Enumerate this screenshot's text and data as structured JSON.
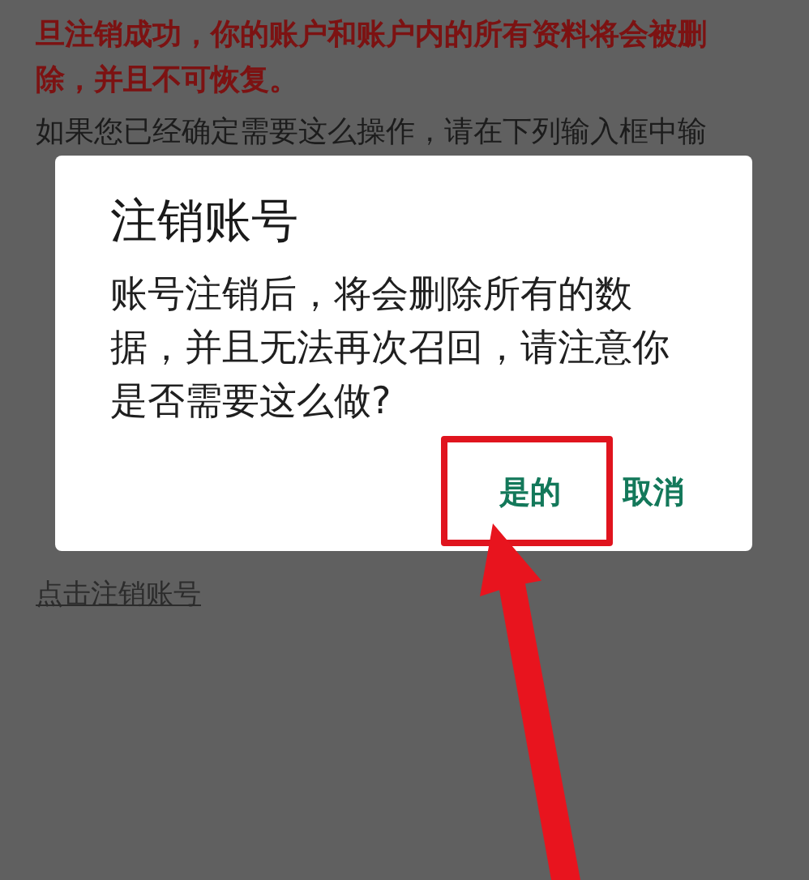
{
  "warning": {
    "lines": [
      "旦注销成功，你的账户和账户内的所有资料将会被删",
      "除，并且不可恢复。"
    ]
  },
  "instructions": "如果您已经确定需要这么操作，请在下列输入框中输",
  "delete_link": "点击注销账号",
  "dialog": {
    "title": "注销账号",
    "message": "账号注销后，将会删除所有的数据，并且无法再次召回，请注意你是否需要这么做?",
    "buttons": [
      {
        "label": "是的",
        "highlighted": true
      },
      {
        "label": "取消",
        "highlighted": false
      }
    ]
  }
}
